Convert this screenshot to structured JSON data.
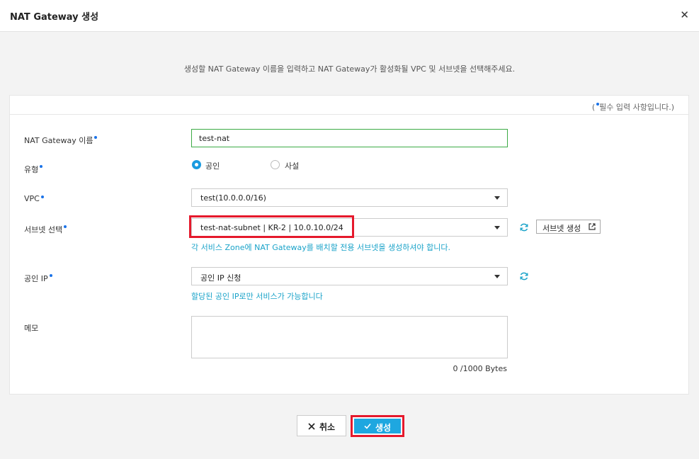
{
  "dialog": {
    "title": "NAT Gateway 생성",
    "close_icon": "✕"
  },
  "description": "생성할 NAT Gateway 이름을 입력하고 NAT Gateway가 활성화될 VPC 및 서브넷을 선택해주세요.",
  "required_note": {
    "open": "(",
    "text": "필수 입력 사항입니다.)"
  },
  "form": {
    "name": {
      "label": "NAT Gateway 이름",
      "value": "test-nat"
    },
    "type": {
      "label": "유형",
      "options": [
        "공인",
        "사설"
      ],
      "selected": "공인"
    },
    "vpc": {
      "label": "VPC",
      "value": "test(10.0.0.0/16)"
    },
    "subnet": {
      "label": "서브넷 선택",
      "value": "test-nat-subnet | KR-2 | 10.0.10.0/24",
      "hint": "각 서비스 Zone에 NAT Gateway를 배치할 전용 서브넷을 생성하셔야 합니다.",
      "create_label": "서브넷 생성"
    },
    "public_ip": {
      "label": "공인 IP",
      "value": "공인 IP 신청",
      "hint": "할당된 공인 IP로만 서비스가 가능합니다"
    },
    "memo": {
      "label": "메모",
      "value": "",
      "counter": "0 /1000 Bytes"
    }
  },
  "actions": {
    "cancel_label": "취소",
    "create_label": "생성"
  },
  "colors": {
    "accent": "#1ea7e0",
    "required_dot": "#1a73e8",
    "highlight": "#e5192c",
    "hint": "#1aa3c9"
  }
}
